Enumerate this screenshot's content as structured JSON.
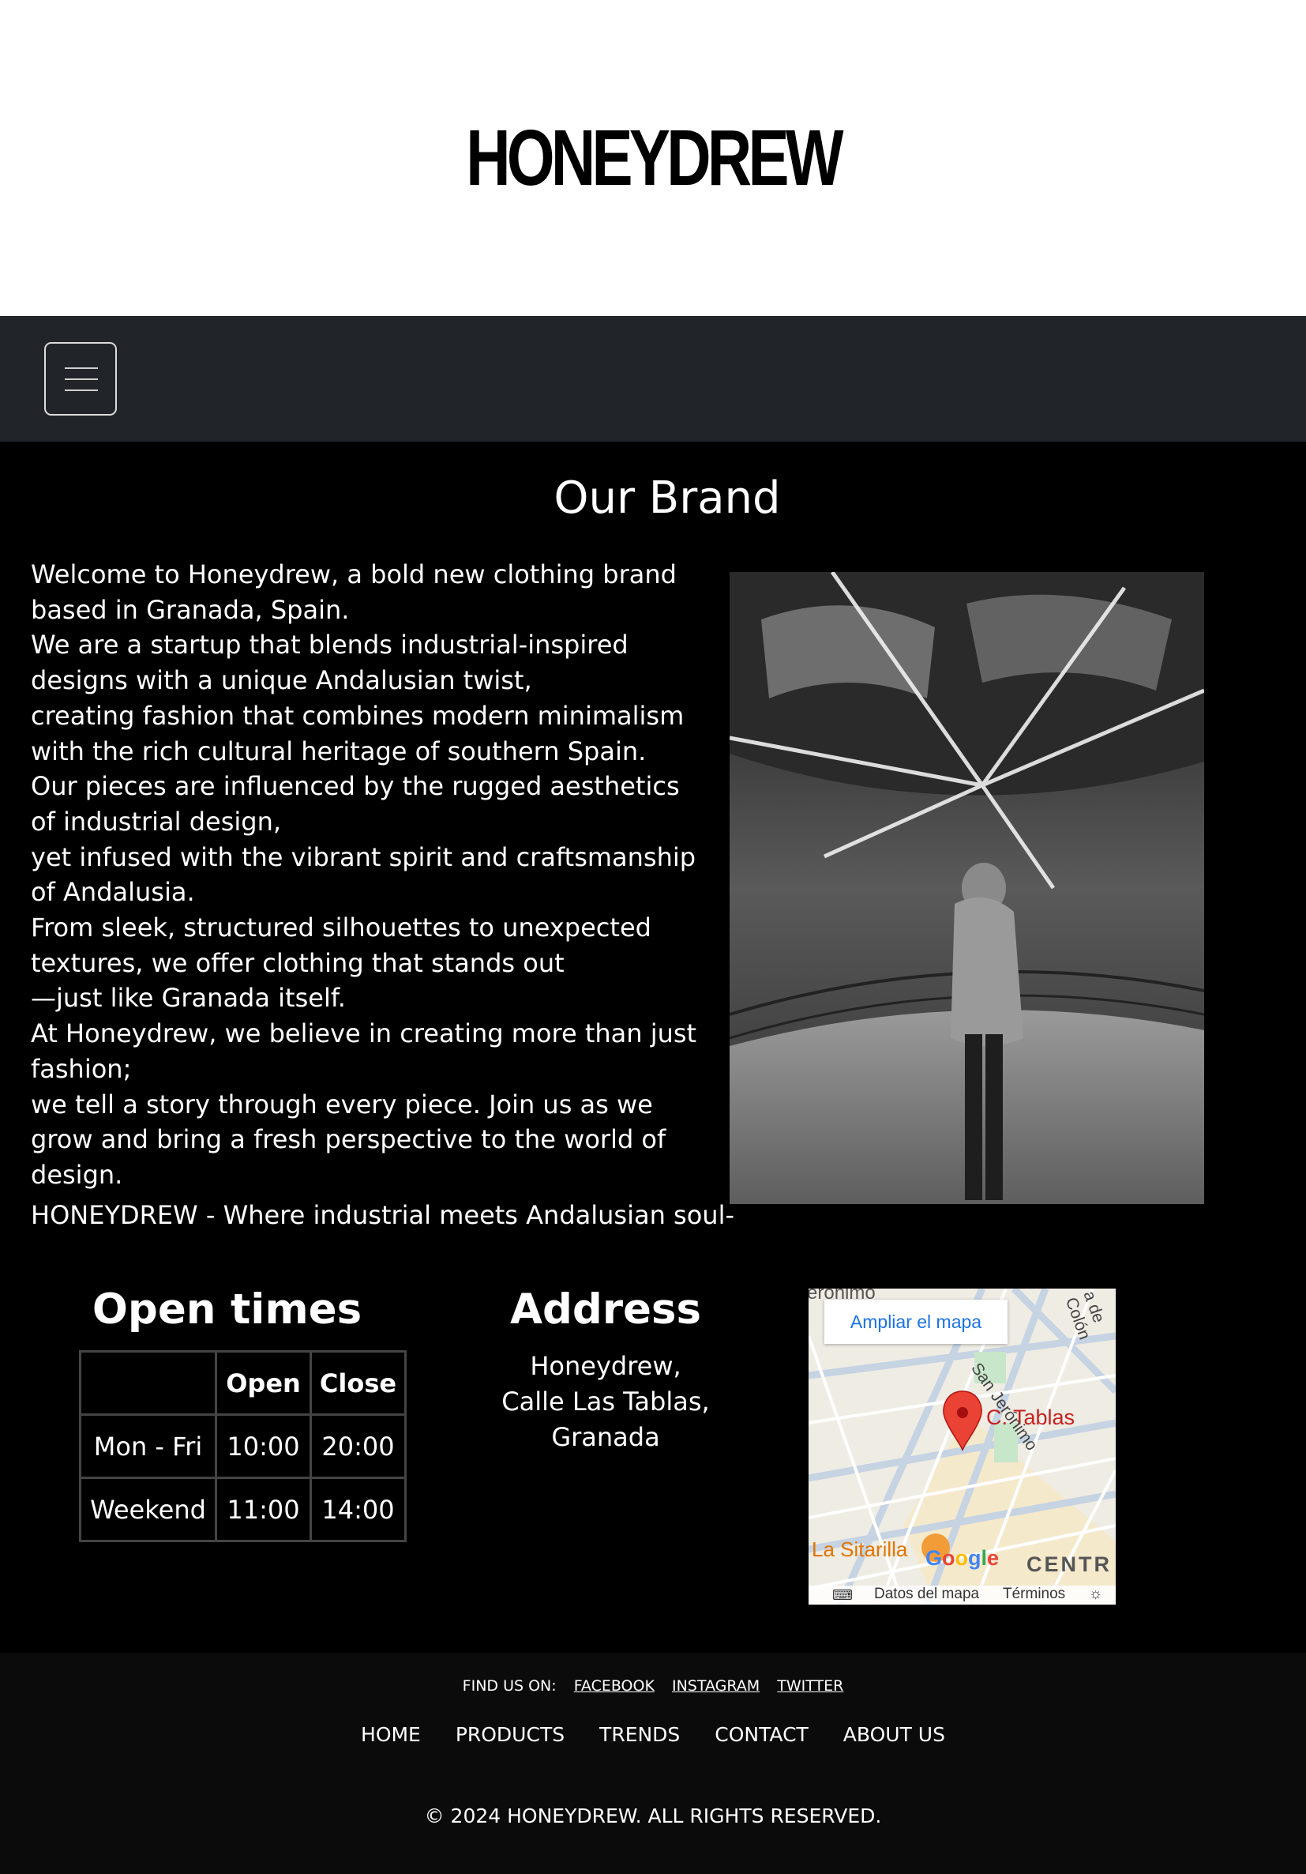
{
  "header": {
    "logo": "HONEYDREW"
  },
  "navbar": {
    "toggle_icon": "hamburger-menu-icon"
  },
  "brand": {
    "title": "Our Brand",
    "paragraphs": [
      "Welcome to Honeydrew, a bold new clothing brand based in Granada, Spain.",
      "We are a startup that blends industrial-inspired designs with a unique Andalusian twist,",
      "creating fashion that combines modern minimalism with the rich cultural heritage of southern Spain.",
      "Our pieces are influenced by the rugged aesthetics of industrial design,",
      "yet infused with the vibrant spirit and craftsmanship of Andalusia.",
      "From sleek, structured silhouettes to unexpected textures, we offer clothing that stands out",
      "—just like Granada itself.",
      "At Honeydrew, we believe in creating more than just fashion;",
      "we tell a story through every piece. Join us as we grow and bring a fresh perspective to the world of design."
    ],
    "tagline": "HONEYDREW - Where industrial meets Andalusian soul-"
  },
  "hours": {
    "title": "Open times",
    "headers": [
      "",
      "Open",
      "Close"
    ],
    "rows": [
      [
        "Mon - Fri",
        "10:00",
        "20:00"
      ],
      [
        "Weekend",
        "11:00",
        "14:00"
      ]
    ]
  },
  "address": {
    "title": "Address",
    "lines": [
      "Honeydrew,",
      "Calle Las Tablas,",
      "Granada"
    ]
  },
  "map": {
    "enlarge_label": "Ampliar el mapa",
    "pin_label": "C. Tablas",
    "poi_label": "La Sitarilla",
    "district_label": "CENTR",
    "street_top": "erónimo",
    "street_diag": "San Jerónimo",
    "street_right": "a de Colón",
    "google_logo": "Google",
    "footer_data": "Datos del mapa",
    "footer_terms": "Términos"
  },
  "footer": {
    "find_us_label": "FIND US ON:",
    "social": [
      "FACEBOOK",
      "INSTAGRAM",
      "TWITTER"
    ],
    "nav": [
      "HOME",
      "PRODUCTS",
      "TRENDS",
      "CONTACT",
      "ABOUT US"
    ],
    "copyright": "© 2024 HONEYDREW. ALL RIGHTS RESERVED."
  }
}
